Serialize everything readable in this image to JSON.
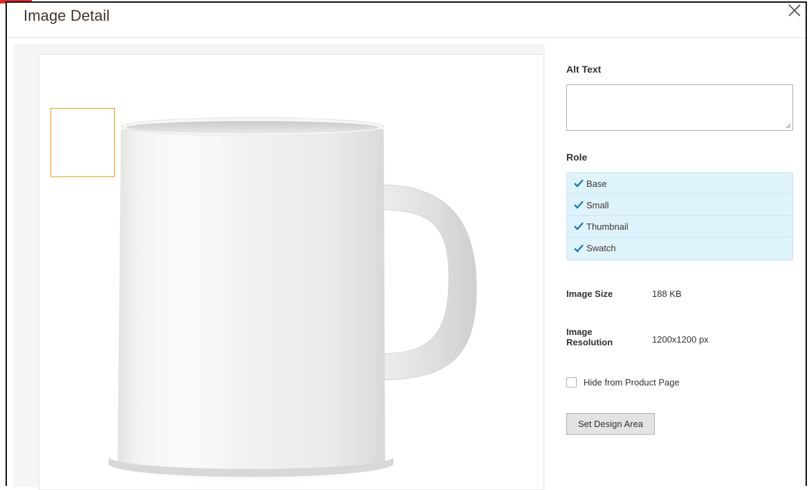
{
  "modal": {
    "title": "Image Detail",
    "close_icon": "close-icon"
  },
  "image": {
    "subject_icon": "mug-image",
    "accent_color": "#eb9b1c"
  },
  "alt_text": {
    "label": "Alt Text",
    "value": "",
    "placeholder": ""
  },
  "role": {
    "label": "Role",
    "items": [
      {
        "label": "Base",
        "checked": true
      },
      {
        "label": "Small",
        "checked": true
      },
      {
        "label": "Thumbnail",
        "checked": true
      },
      {
        "label": "Swatch",
        "checked": true
      }
    ],
    "highlight_color": "#def3fb",
    "check_color": "#007bdb"
  },
  "info": {
    "size_label": "Image Size",
    "size_value": "188 KB",
    "resolution_label": "Image Resolution",
    "resolution_value": "1200x1200 px"
  },
  "hide_from_product_page": {
    "label": "Hide from Product Page",
    "checked": false
  },
  "actions": {
    "set_design_area_label": "Set Design Area"
  }
}
